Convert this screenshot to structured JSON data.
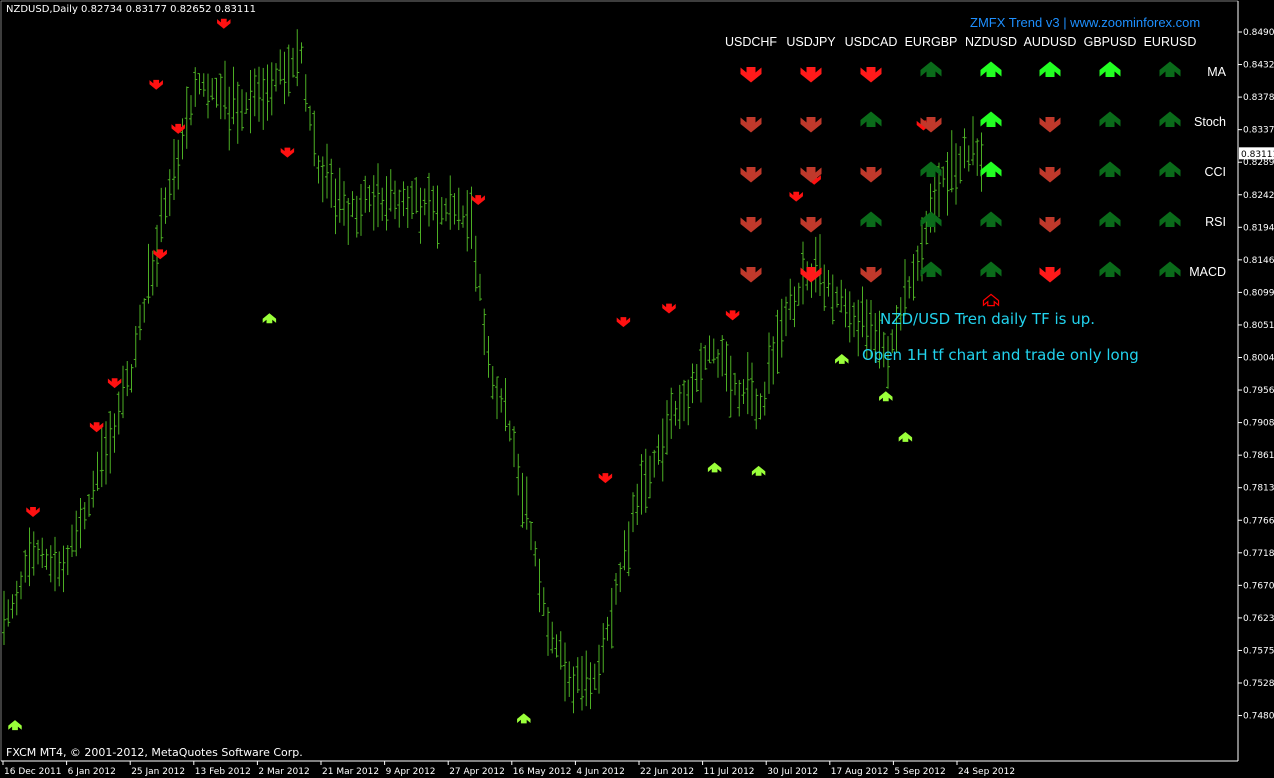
{
  "window": {
    "symbol_header": "NZDUSD,Daily  0.82734 0.83177 0.82652 0.83111",
    "copyright": "FXCM MT4, © 2001-2012, MetaQuotes Software Corp."
  },
  "panel": {
    "brand": "ZMFX Trend v3 | www.zoominforex.com",
    "pairs": [
      "USDCHF",
      "USDJPY",
      "USDCAD",
      "EURGBP",
      "NZDUSD",
      "AUDUSD",
      "GBPUSD",
      "EURUSD"
    ],
    "indicators": [
      "MA",
      "Stoch",
      "CCI",
      "RSI",
      "MACD"
    ],
    "signals": [
      [
        "down-strong",
        "down-strong",
        "down-strong",
        "up-dark",
        "up-bright",
        "up-bright",
        "up-bright",
        "up-dark"
      ],
      [
        "down",
        "down",
        "up-dark",
        "down",
        "up-bright",
        "down",
        "up-dark",
        "up-dark"
      ],
      [
        "down",
        "down",
        "down",
        "up-dark",
        "up-bright",
        "down",
        "up-dark",
        "up-dark"
      ],
      [
        "down",
        "down",
        "up-dark",
        "up-dark",
        "up-dark",
        "down",
        "up-dark",
        "up-dark"
      ],
      [
        "down",
        "down-strong",
        "down",
        "up-dark",
        "up-dark",
        "down-strong",
        "up-dark",
        "up-dark"
      ]
    ],
    "marker": "NZDUSD-up-outline",
    "colors": {
      "down": "#c0392b",
      "down-strong": "#ff1a1a",
      "up-dark": "#0a6b1a",
      "up-bright": "#22ff22",
      "marker": "#ff0000"
    }
  },
  "notes": {
    "line1": "NZD/USD Tren daily TF is up.",
    "line2": "Open 1H tf chart and trade only long"
  },
  "chart_data": {
    "type": "ohlc-bar",
    "symbol": "NZDUSD",
    "timeframe": "Daily",
    "current_price": "0.83111",
    "y_ticks": [
      "0.84900",
      "0.84320",
      "0.83780",
      "0.83370",
      "0.82890",
      "0.82420",
      "0.81940",
      "0.81460",
      "0.80990",
      "0.80510",
      "0.80040",
      "0.79560",
      "0.79080",
      "0.78610",
      "0.78130",
      "0.77660",
      "0.77180",
      "0.76700",
      "0.76230",
      "0.75750",
      "0.75280",
      "0.74800"
    ],
    "x_ticks": [
      "16 Dec 2011",
      "6 Jan 2012",
      "25 Jan 2012",
      "13 Feb 2012",
      "2 Mar 2012",
      "21 Mar 2012",
      "9 Apr 2012",
      "27 Apr 2012",
      "16 May 2012",
      "4 Jun 2012",
      "22 Jun 2012",
      "11 Jul 2012",
      "30 Jul 2012",
      "17 Aug 2012",
      "5 Sep 2012",
      "24 Sep 2012"
    ],
    "bar_color": "#4caf24",
    "path_closes": [
      [
        0,
        0.7615
      ],
      [
        7,
        0.7725
      ],
      [
        14,
        0.77
      ],
      [
        22,
        0.783
      ],
      [
        30,
        0.7985
      ],
      [
        38,
        0.8235
      ],
      [
        46,
        0.8415
      ],
      [
        54,
        0.8375
      ],
      [
        62,
        0.841
      ],
      [
        70,
        0.845
      ],
      [
        74,
        0.829
      ],
      [
        80,
        0.822
      ],
      [
        88,
        0.8245
      ],
      [
        96,
        0.8235
      ],
      [
        104,
        0.8225
      ],
      [
        110,
        0.8215
      ],
      [
        114,
        0.8
      ],
      [
        120,
        0.788
      ],
      [
        128,
        0.761
      ],
      [
        134,
        0.7525
      ],
      [
        140,
        0.7545
      ],
      [
        148,
        0.777
      ],
      [
        154,
        0.7875
      ],
      [
        160,
        0.794
      ],
      [
        166,
        0.803
      ],
      [
        172,
        0.7965
      ],
      [
        178,
        0.793
      ],
      [
        184,
        0.808
      ],
      [
        190,
        0.813
      ],
      [
        196,
        0.81
      ],
      [
        202,
        0.806
      ],
      [
        208,
        0.801
      ],
      [
        214,
        0.8135
      ],
      [
        220,
        0.827
      ],
      [
        226,
        0.831
      ],
      [
        230,
        0.8311
      ]
    ],
    "sell_arrows": [
      [
        "16 Dec 2011",
        0.777
      ],
      [
        "6 Jan 2012",
        0.7895
      ],
      [
        "6 Jan 2012",
        0.796
      ],
      [
        "25 Jan 2012",
        0.815
      ],
      [
        "25 Jan 2012",
        0.8335
      ],
      [
        "25 Jan 2012",
        0.84
      ],
      [
        "13 Feb 2012",
        0.849
      ],
      [
        "2 Mar 2012",
        0.83
      ],
      [
        "27 Apr 2012",
        0.823
      ],
      [
        "4 Jun 2012",
        0.782
      ],
      [
        "4 Jun 2012",
        0.805
      ],
      [
        "22 Jun 2012",
        0.807
      ],
      [
        "11 Jul 2012",
        0.806
      ],
      [
        "30 Jul 2012",
        0.8235
      ],
      [
        "30 Jul 2012",
        0.826
      ],
      [
        "5 Sep 2012",
        0.834
      ]
    ],
    "buy_arrows": [
      [
        "16 Dec 2011",
        0.748
      ],
      [
        "2 Mar 2012",
        0.808
      ],
      [
        "16 May 2012",
        0.749
      ],
      [
        "11 Jul 2012",
        0.786
      ],
      [
        "11 Jul 2012",
        0.7855
      ],
      [
        "17 Aug 2012",
        0.802
      ],
      [
        "17 Aug 2012",
        0.7965
      ],
      [
        "5 Sep 2012",
        0.7905
      ]
    ]
  }
}
